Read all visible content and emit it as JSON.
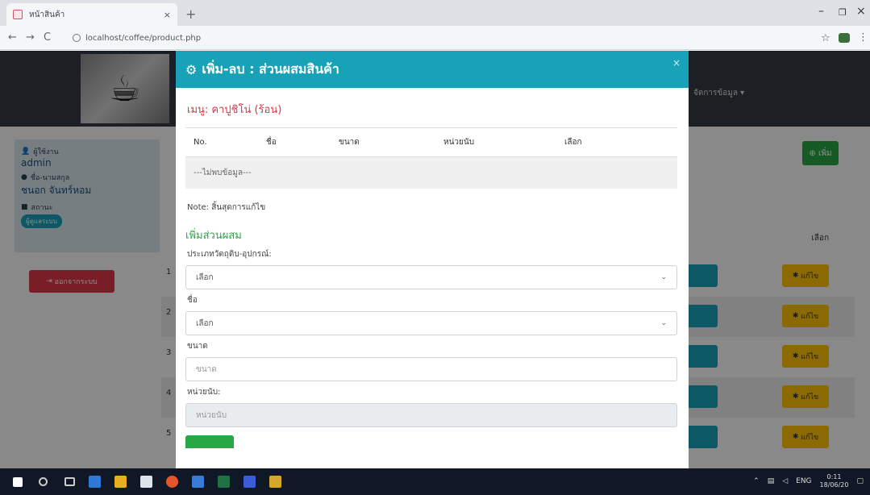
{
  "browser": {
    "tab_title": "หน้าสินค้า",
    "tab_close": "×",
    "new_tab": "+",
    "url": "localhost/coffee/product.php",
    "win_min": "–",
    "win_max": "❐",
    "win_close": "×"
  },
  "app": {
    "navbar": {
      "logo_icon": "coffee-cup-icon",
      "menu_label": "จัดการข้อมูล ▾"
    },
    "sidebar": {
      "user_label": "ผู้ใช้งาน",
      "user_value": "admin",
      "name_label": "ชื่อ-นามสกุล",
      "name_value": "ชนอก จันทร์หอม",
      "status_label": "สถานะ",
      "status_badge": "ผู้ดูแลระบบ"
    },
    "logout_label": "ออกจากระบบ",
    "add_label": "เพิ่ม",
    "manage_header": "เลือก",
    "row_numbers": [
      "1",
      "2",
      "3",
      "4",
      "5"
    ],
    "edit_label": "แก้ไข"
  },
  "modal": {
    "title": "เพิ่ม-ลบ : ส่วนผสมสินค้า",
    "close": "×",
    "menu_title": "เมนู: คาปูชิโน่ (ร้อน)",
    "table": {
      "headers": [
        "No.",
        "ชื่อ",
        "ขนาด",
        "หน่วยนับ",
        "เลือก"
      ],
      "empty_text": "---ไม่พบข้อมูล---"
    },
    "note": "Note: สิ้นสุดการแก้ไข",
    "section_title": "เพิ่มส่วนผสม",
    "fields": {
      "type_label": "ประเภทวัตถุดิบ-อุปกรณ์:",
      "type_value": "เลือก",
      "name_label": "ชื่อ",
      "name_value": "เลือก",
      "size_label": "ขนาด",
      "size_placeholder": "ขนาด",
      "unit_label": "หน่วยนับ:",
      "unit_placeholder": "หน่วยนับ"
    }
  },
  "taskbar": {
    "tray_lang": "ENG",
    "time": "0:11",
    "date": "18/06/20"
  },
  "colors": {
    "teal": "#17a2b8",
    "red": "#dc3545",
    "green": "#28a745",
    "yellow": "#ffc107",
    "navbar": "#343a40"
  }
}
